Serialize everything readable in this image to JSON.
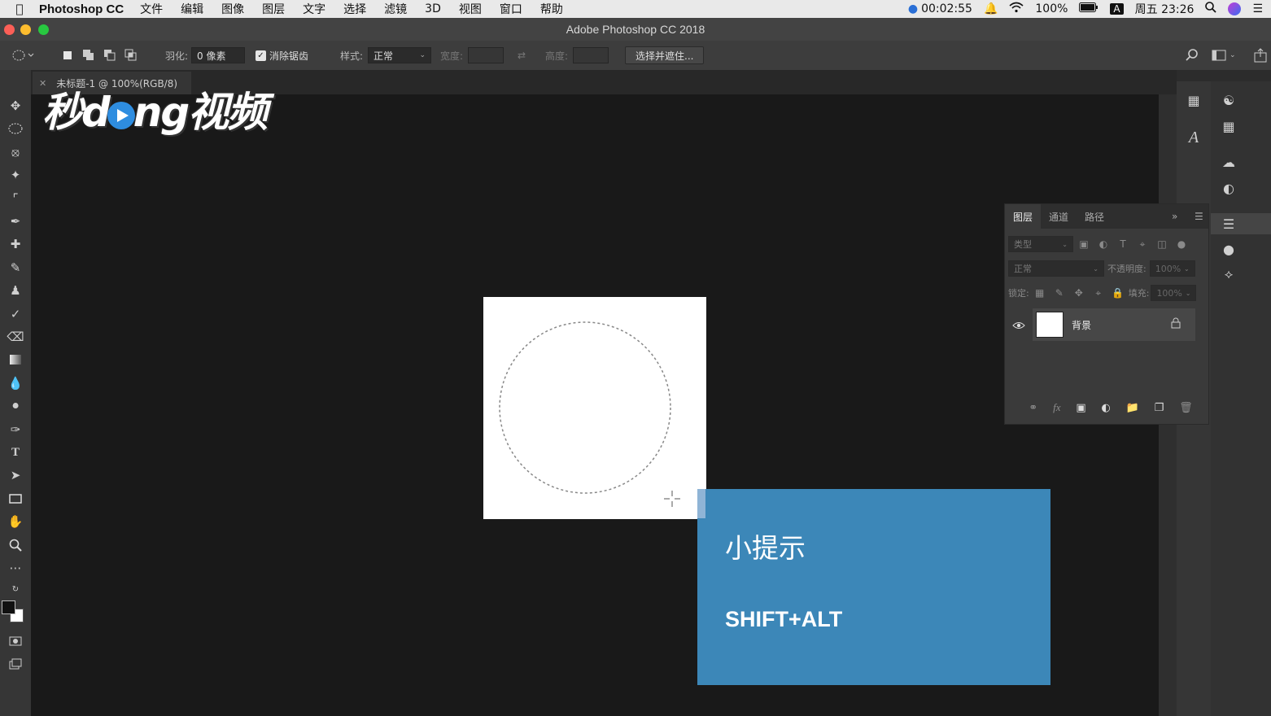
{
  "menubar": {
    "app_name": "Photoshop CC",
    "menus": [
      "文件",
      "编辑",
      "图像",
      "图层",
      "文字",
      "选择",
      "滤镜",
      "3D",
      "视图",
      "窗口",
      "帮助"
    ],
    "time_recording": "00:02:55",
    "battery": "100%",
    "input_method": "A",
    "clock": "周五 23:26"
  },
  "window": {
    "title": "Adobe Photoshop CC 2018"
  },
  "options_bar": {
    "feather_label": "羽化:",
    "feather_value": "0 像素",
    "antialias_label": "消除锯齿",
    "antialias_checked": true,
    "style_label": "样式:",
    "style_value": "正常",
    "width_label": "宽度:",
    "height_label": "高度:",
    "select_mask_button": "选择并遮住..."
  },
  "document": {
    "tab_title": "未标题-1 @ 100%(RGB/8)"
  },
  "watermark": {
    "text_before": "秒d",
    "text_after": "ng视频"
  },
  "layers_panel": {
    "tabs": [
      "图层",
      "通道",
      "路径"
    ],
    "active_tab": "图层",
    "filter_kind": "类型",
    "blend_mode": "正常",
    "opacity_label": "不透明度:",
    "opacity_value": "100%",
    "lock_label": "锁定:",
    "fill_label": "填充:",
    "fill_value": "100%",
    "layers": [
      {
        "name": "背景",
        "visible": true,
        "locked": true
      }
    ]
  },
  "tip": {
    "title": "小提示",
    "text": "SHIFT+ALT",
    "color": "#3c87b8"
  }
}
